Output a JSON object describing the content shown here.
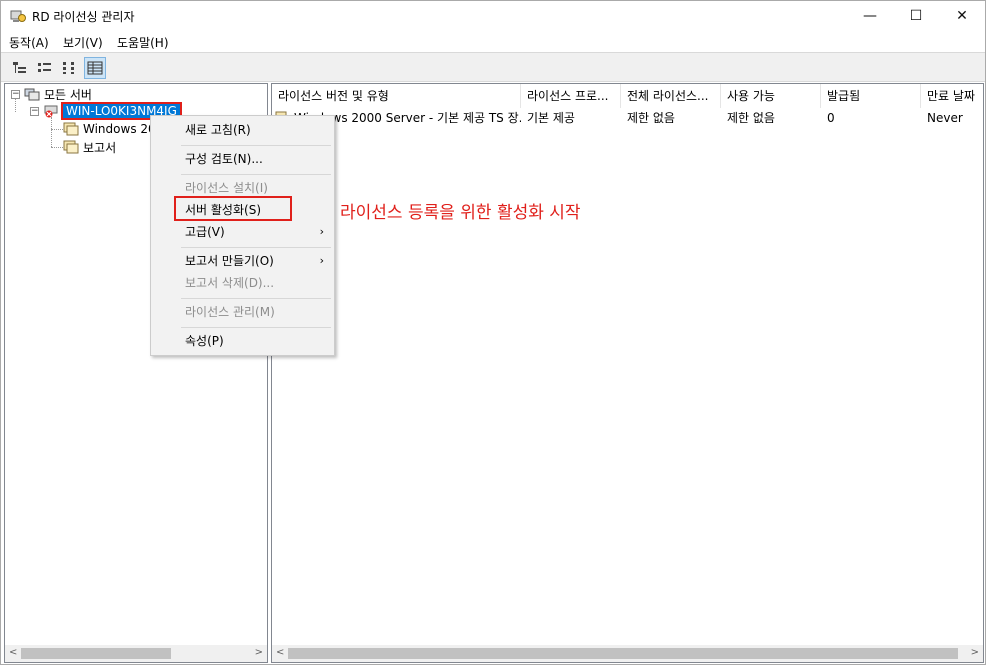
{
  "window": {
    "title": "RD 라이선싱 관리자",
    "minimize": "—",
    "maximize": "☐",
    "close": "✕"
  },
  "menu": [
    "동작(A)",
    "보기(V)",
    "도움말(H)"
  ],
  "toolbar": {
    "buttons": [
      "tree-view-icon",
      "small-icons-icon",
      "list-icon",
      "details-icon"
    ],
    "active": "details-icon"
  },
  "tree": {
    "root": "모든 서버",
    "server": "WIN-LO0KI3NM4JG",
    "children": [
      "Windows 20",
      "보고서"
    ],
    "expand_root": "−",
    "expand_server": "−"
  },
  "table": {
    "headers": [
      "라이선스 버전 및 유형",
      "라이선스 프로...",
      "전체 라이선스...",
      "사용 가능",
      "발급됨",
      "만료 날짜"
    ],
    "rows": [
      [
        "Windows 2000 Server - 기본 제공 TS 장...",
        "기본 제공",
        "제한 없음",
        "제한 없음",
        "0",
        "Never"
      ]
    ]
  },
  "context_menu": {
    "items": [
      {
        "label": "새로 고침(R)",
        "enabled": true,
        "submenu": false
      },
      {
        "label": "구성 검토(N)...",
        "enabled": true,
        "submenu": false
      },
      {
        "label": "라이선스 설치(I)",
        "enabled": false,
        "submenu": false
      },
      {
        "label": "서버 활성화(S)",
        "enabled": true,
        "submenu": false
      },
      {
        "label": "고급(V)",
        "enabled": true,
        "submenu": true
      },
      {
        "label": "보고서 만들기(O)",
        "enabled": true,
        "submenu": true
      },
      {
        "label": "보고서 삭제(D)...",
        "enabled": false,
        "submenu": false
      },
      {
        "label": "라이선스 관리(M)",
        "enabled": false,
        "submenu": false
      },
      {
        "label": "속성(P)",
        "enabled": true,
        "submenu": false
      }
    ],
    "submenu_arrow": "›"
  },
  "annotation": "라이선스 등록을 위한 활성화 시작",
  "scroll": {
    "left_arrow": "<",
    "right_arrow": ">"
  },
  "colors": {
    "accent": "#0078d7",
    "annotation": "#e0201b"
  }
}
